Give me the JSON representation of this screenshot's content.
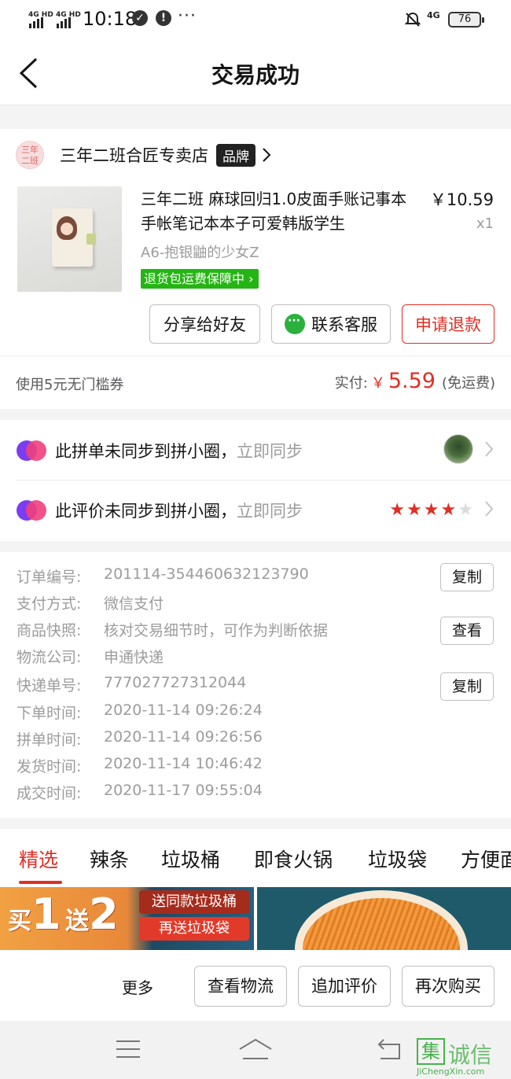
{
  "status_bar": {
    "sig1": "4G HD",
    "sig2": "4G HD",
    "time": "10:18",
    "net": "4G",
    "battery": "76"
  },
  "nav": {
    "title": "交易成功"
  },
  "store": {
    "logo_text": "三年\n二班",
    "name": "三年二班合匠专卖店",
    "brand_tag": "品牌"
  },
  "product": {
    "name": "三年二班 麻球回归1.0皮面手账记事本手帐笔记本本子可爱韩版学生",
    "price": "￥10.59",
    "qty": "x1",
    "spec": "A6-抱银鼬的少女Z",
    "guarantee": "退货包运费保障中"
  },
  "product_actions": {
    "share": "分享给好友",
    "contact": "联系客服",
    "refund": "申请退款"
  },
  "payment": {
    "coupon": "使用5元无门槛券",
    "paid_label": "实付:",
    "currency": "￥",
    "amount": "5.59",
    "shipping": "(免运费)"
  },
  "sync": {
    "group_text": "此拼单未同步到拼小圈，",
    "group_link": "立即同步",
    "review_text": "此评价未同步到拼小圈，",
    "review_link": "立即同步",
    "rating": 4,
    "rating_max": 5
  },
  "order_info": [
    {
      "key": "订单编号:",
      "value": "201114-354460632123790",
      "button": "复制"
    },
    {
      "key": "支付方式:",
      "value": "微信支付",
      "button": ""
    },
    {
      "key": "商品快照:",
      "value": "核对交易细节时，可作为判断依据",
      "button": "查看"
    },
    {
      "key": "物流公司:",
      "value": "申通快递",
      "button": ""
    },
    {
      "key": "快递单号:",
      "value": "777027727312044",
      "button": "复制"
    },
    {
      "key": "下单时间:",
      "value": "2020-11-14 09:26:24",
      "button": ""
    },
    {
      "key": "拼单时间:",
      "value": "2020-11-14 09:26:56",
      "button": ""
    },
    {
      "key": "发货时间:",
      "value": "2020-11-14 10:46:42",
      "button": ""
    },
    {
      "key": "成交时间:",
      "value": "2020-11-17 09:55:04",
      "button": ""
    }
  ],
  "tabs": [
    "精选",
    "辣条",
    "垃圾桶",
    "即食火锅",
    "垃圾袋",
    "方便面"
  ],
  "banner": {
    "buy": "买",
    "one": "1",
    "give": "送",
    "two": "2",
    "tag1": "送同款垃圾桶",
    "tag2": "再送垃圾袋"
  },
  "bottom_actions": {
    "more": "更多",
    "logistics": "查看物流",
    "add_review": "追加评价",
    "rebuy": "再次购买"
  },
  "watermark": {
    "mark": "集",
    "text": "诚信",
    "site": "JiChengXin.com"
  },
  "colors": {
    "accent": "#e02e24",
    "green": "#25b513",
    "text": "#151516",
    "muted": "#9c9c9c"
  }
}
